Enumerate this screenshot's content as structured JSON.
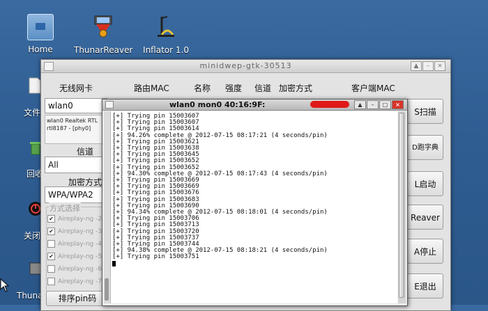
{
  "desktop": {
    "icons": [
      {
        "label": "Home"
      },
      {
        "label": "ThunarReaver"
      },
      {
        "label": "Inflator 1.0"
      }
    ],
    "partial_labels": [
      "文件",
      "回收",
      "关闭",
      "Thuna"
    ]
  },
  "main_window": {
    "title": "minidwep-gtk-30513",
    "column_headers": [
      "无线网卡",
      "路由MAC",
      "名称",
      "强度",
      "信道",
      "加密方式",
      "客户端MAC"
    ],
    "adapter": {
      "value": "wlan0",
      "info": "wlan0 Realtek RTL\nrtl8187 - [phy0]"
    },
    "channel": {
      "label": "信道",
      "value": "All"
    },
    "encryption": {
      "label": "加密方式",
      "value": "WPA/WPA2"
    },
    "modes": {
      "title": "方式选择",
      "items": [
        {
          "label": "Aireplay-ng -2",
          "checked": true
        },
        {
          "label": "Aireplay-ng -3",
          "checked": true
        },
        {
          "label": "Aireplay-ng -4",
          "checked": false
        },
        {
          "label": "Aireplay-ng -5",
          "checked": true
        },
        {
          "label": "Aireplay-ng -6",
          "checked": false
        },
        {
          "label": "Aireplay-ng -7",
          "checked": false
        }
      ]
    },
    "sort_button": "排序pin码",
    "buttons": [
      "S扫描",
      "D跑字典",
      "L启动",
      "Reaver",
      "A停止",
      "E退出"
    ]
  },
  "terminal": {
    "title": "wlan0 mon0 40:16:9F:",
    "lines": [
      "[+] Trying pin 15003607",
      "[+] Trying pin 15003607",
      "[+] Trying pin 15003614",
      "[+] 94.26% complete @ 2012-07-15 08:17:21 (4 seconds/pin)",
      "[+] Trying pin 15003621",
      "[+] Trying pin 15003638",
      "[+] Trying pin 15003645",
      "[+] Trying pin 15003652",
      "[+] Trying pin 15003652",
      "[+] 94.30% complete @ 2012-07-15 08:17:43 (4 seconds/pin)",
      "[+] Trying pin 15003669",
      "[+] Trying pin 15003669",
      "[+] Trying pin 15003676",
      "[+] Trying pin 15003683",
      "[+] Trying pin 15003690",
      "[+] 94.34% complete @ 2012-07-15 08:18:01 (4 seconds/pin)",
      "[+] Trying pin 15003706",
      "[+] Trying pin 15003713",
      "[+] Trying pin 15003720",
      "[+] Trying pin 15003737",
      "[+] Trying pin 15003744",
      "[+] 94.38% complete @ 2012-07-15 08:18:21 (4 seconds/pin)",
      "[+] Trying pin 15003751"
    ]
  },
  "colors": {
    "desktop_bg": "#2f5d92",
    "close_button": "#d9342a",
    "redaction": "#e01919"
  }
}
